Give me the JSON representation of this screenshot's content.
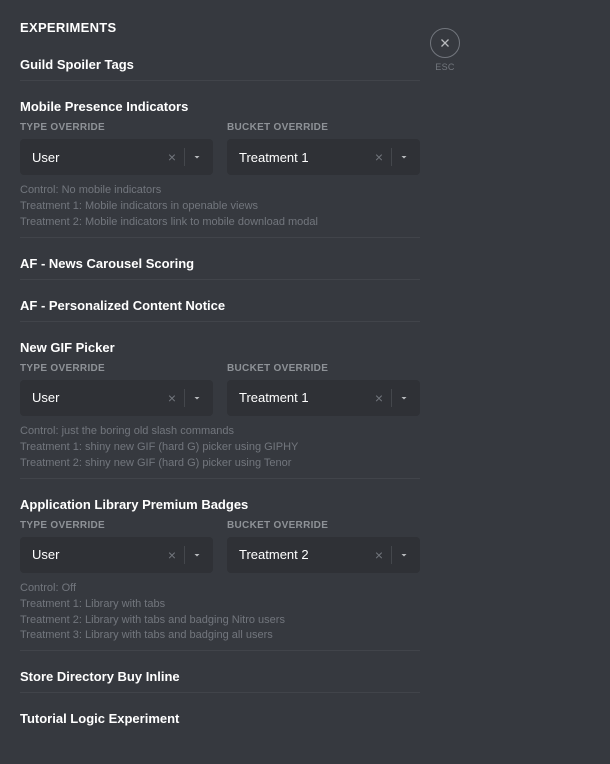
{
  "page_title": "EXPERIMENTS",
  "close": {
    "esc_label": "ESC"
  },
  "labels": {
    "type_override": "TYPE OVERRIDE",
    "bucket_override": "BUCKET OVERRIDE"
  },
  "sections": [
    {
      "title": "Guild Spoiler Tags"
    },
    {
      "title": "Mobile Presence Indicators",
      "type_value": "User",
      "bucket_value": "Treatment 1",
      "desc": [
        "Control: No mobile indicators",
        "Treatment 1: Mobile indicators in openable views",
        "Treatment 2: Mobile indicators link to mobile download modal"
      ]
    },
    {
      "title": "AF - News Carousel Scoring"
    },
    {
      "title": "AF - Personalized Content Notice"
    },
    {
      "title": "New GIF Picker",
      "type_value": "User",
      "bucket_value": "Treatment 1",
      "desc": [
        "Control: just the boring old slash commands",
        "Treatment 1: shiny new GIF (hard G) picker using GIPHY",
        "Treatment 2: shiny new GIF (hard G) picker using Tenor"
      ]
    },
    {
      "title": "Application Library Premium Badges",
      "type_value": "User",
      "bucket_value": "Treatment 2",
      "desc": [
        "Control: Off",
        "Treatment 1: Library with tabs",
        "Treatment 2: Library with tabs and badging Nitro users",
        "Treatment 3: Library with tabs and badging all users"
      ]
    },
    {
      "title": "Store Directory Buy Inline"
    },
    {
      "title": "Tutorial Logic Experiment"
    }
  ]
}
